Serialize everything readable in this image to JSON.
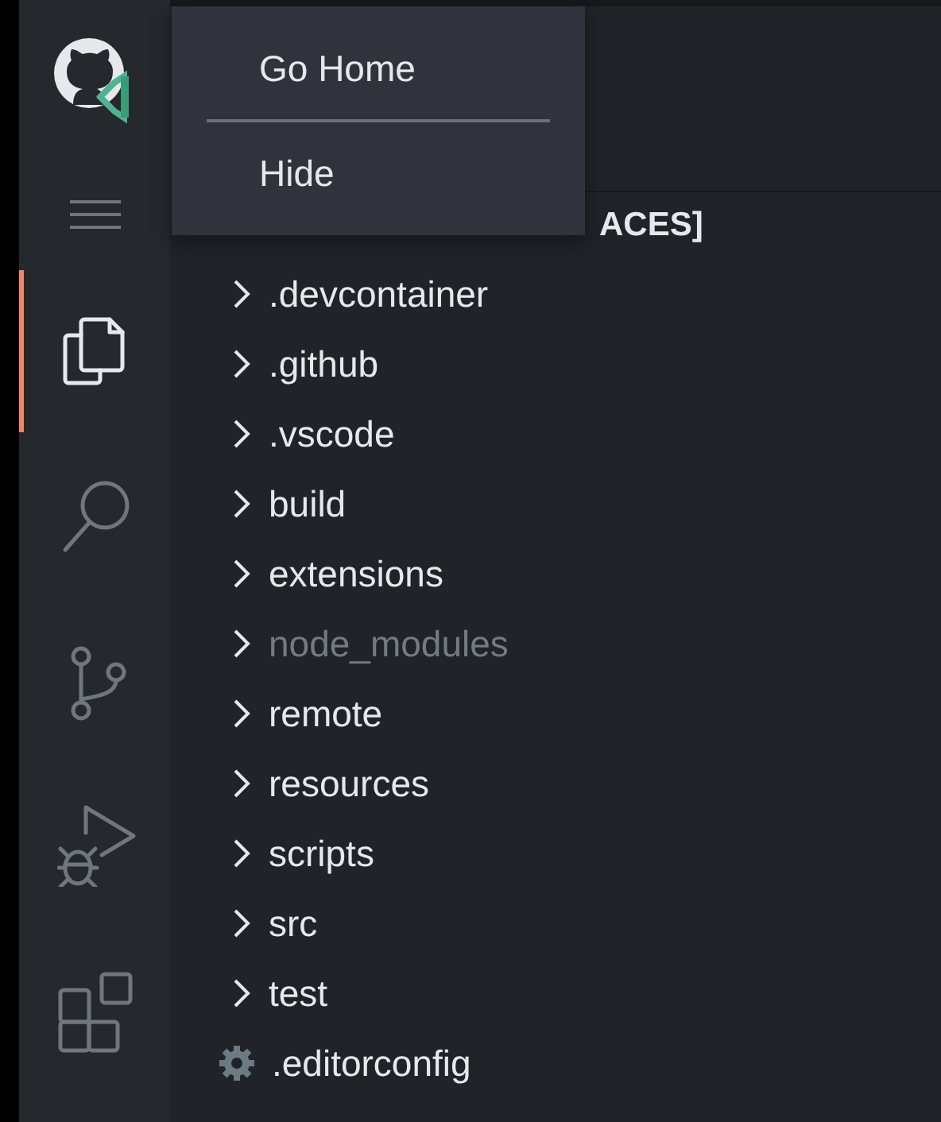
{
  "context_menu": {
    "items": [
      {
        "label": "Go Home",
        "kind": "item"
      },
      {
        "kind": "separator"
      },
      {
        "label": "Hide",
        "kind": "item"
      }
    ]
  },
  "activity_bar": {
    "items": [
      {
        "kind": "files",
        "selected": true
      },
      {
        "kind": "search",
        "selected": false
      },
      {
        "kind": "source-control",
        "selected": false
      },
      {
        "kind": "debug",
        "selected": false
      },
      {
        "kind": "extensions",
        "selected": false
      }
    ]
  },
  "explorer": {
    "title": "ACES]",
    "items": [
      {
        "label": ".devcontainer",
        "kind": "folder",
        "dimmed": false
      },
      {
        "label": ".github",
        "kind": "folder",
        "dimmed": false
      },
      {
        "label": ".vscode",
        "kind": "folder",
        "dimmed": false
      },
      {
        "label": "build",
        "kind": "folder",
        "dimmed": false
      },
      {
        "label": "extensions",
        "kind": "folder",
        "dimmed": false
      },
      {
        "label": "node_modules",
        "kind": "folder",
        "dimmed": true
      },
      {
        "label": "remote",
        "kind": "folder",
        "dimmed": false
      },
      {
        "label": "resources",
        "kind": "folder",
        "dimmed": false
      },
      {
        "label": "scripts",
        "kind": "folder",
        "dimmed": false
      },
      {
        "label": "src",
        "kind": "folder",
        "dimmed": false
      },
      {
        "label": "test",
        "kind": "folder",
        "dimmed": false
      },
      {
        "label": ".editorconfig",
        "kind": "config",
        "dimmed": false
      }
    ]
  }
}
